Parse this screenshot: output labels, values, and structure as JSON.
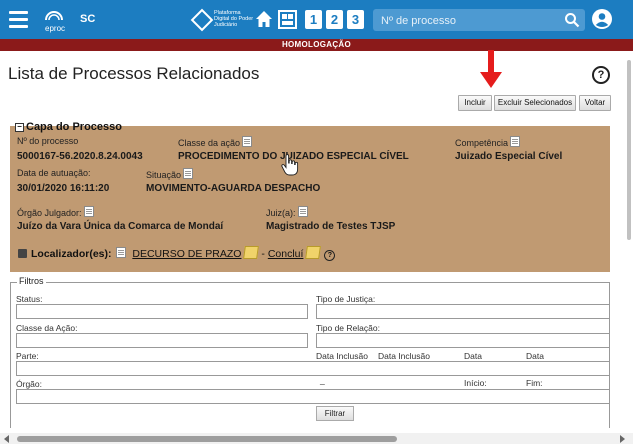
{
  "topbar": {
    "logo_text": "eproc",
    "state": "SC",
    "platform_text": "Plataforma Digital do Poder Judiciário",
    "quick_buttons": [
      "1",
      "2",
      "3"
    ],
    "search_placeholder": "Nº de processo",
    "accent_color": "#1c7dc1"
  },
  "environment_banner": "HOMOLOGAÇÃO",
  "page": {
    "title": "Lista de Processos Relacionados",
    "help_symbol": "?"
  },
  "actions": {
    "incluir": "Incluir",
    "excluir": "Excluir Selecionados",
    "voltar": "Voltar"
  },
  "capa": {
    "title": "Capa do Processo",
    "collapse_symbol": "−",
    "fields": {
      "numero_label": "Nº do processo",
      "numero_value": "5000167-56.2020.8.24.0043",
      "classe_label": "Classe da ação",
      "classe_value": "PROCEDIMENTO DO JUIZADO ESPECIAL CÍVEL",
      "competencia_label": "Competência",
      "competencia_value": "Juizado Especial Cível",
      "autuacao_label": "Data de autuação:",
      "autuacao_value": "30/01/2020 16:11:20",
      "situacao_label": "Situação",
      "situacao_value": "MOVIMENTO-AGUARDA DESPACHO",
      "orgao_label": "Órgão Julgador:",
      "orgao_value": "Juízo da Vara Única da Comarca de Mondaí",
      "juiz_label": "Juiz(a):",
      "juiz_value": "Magistrado de Testes TJSP"
    },
    "localizador": {
      "label": "Localizador(es):",
      "item1": "DECURSO DE PRAZO",
      "separator": "-",
      "item2": "Concluí",
      "help": "?"
    },
    "background_color": "#c09a72"
  },
  "filtros": {
    "title": "Filtros",
    "status": "Status:",
    "tipo_justica": "Tipo de Justiça:",
    "classe_acao": "Classe da Ação:",
    "tipo_relacao": "Tipo de Relação:",
    "parte": "Parte:",
    "data_inclusao_1": "Data Inclusão",
    "data_inclusao_2": "Data Inclusão",
    "data_1": "Data",
    "data_2": "Data",
    "orgao": "Órgão:",
    "underscore": "_",
    "inicio": "Início:",
    "fim": "Fim:",
    "button": "Filtrar"
  }
}
